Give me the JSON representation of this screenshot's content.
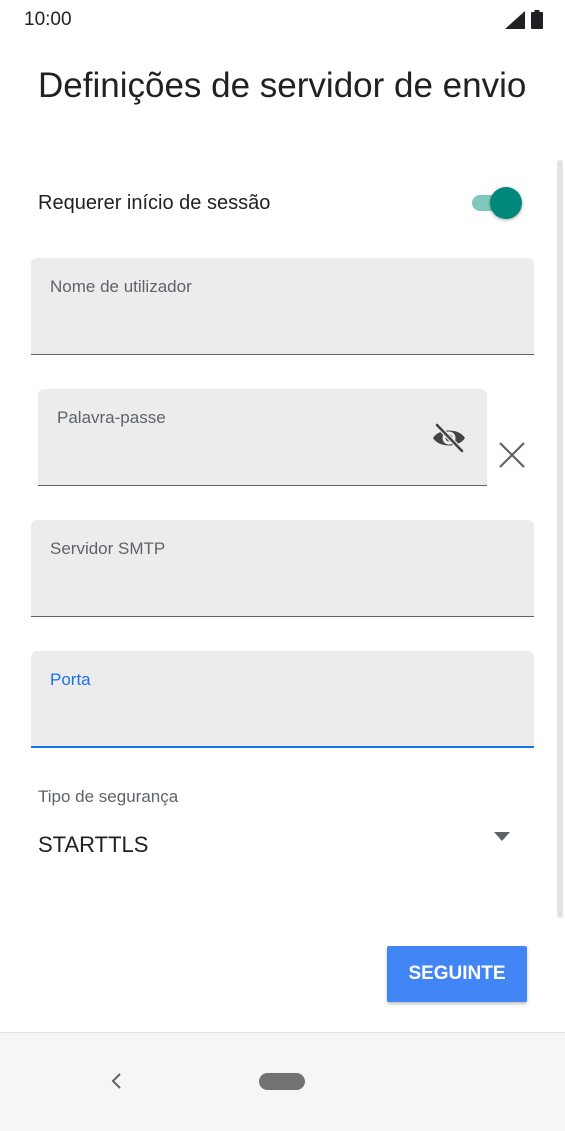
{
  "status_bar": {
    "time": "10:00",
    "icons": [
      "signal-icon",
      "battery-icon"
    ]
  },
  "page": {
    "title": "Definições de servidor de envio"
  },
  "login_toggle": {
    "label": "Requerer início de sessão",
    "on": true,
    "accent": "#00897b"
  },
  "fields": {
    "username": {
      "label": "Nome de utilizador",
      "value": ""
    },
    "password": {
      "label": "Palavra-passe",
      "value": "",
      "icons": [
        "visibility-off-icon",
        "close-icon"
      ]
    },
    "smtp_server": {
      "label": "Servidor SMTP",
      "value": ""
    },
    "port": {
      "label": "Porta",
      "value": "",
      "focused": true,
      "accent": "#1a73e8"
    }
  },
  "security": {
    "label": "Tipo de segurança",
    "selected": "STARTTLS",
    "icon": "dropdown-arrow-icon"
  },
  "actions": {
    "next_label": "SEGUINTE",
    "button_color": "#4285f4"
  },
  "nav_bar": {
    "icons": [
      "back-icon",
      "home-pill-icon"
    ]
  }
}
